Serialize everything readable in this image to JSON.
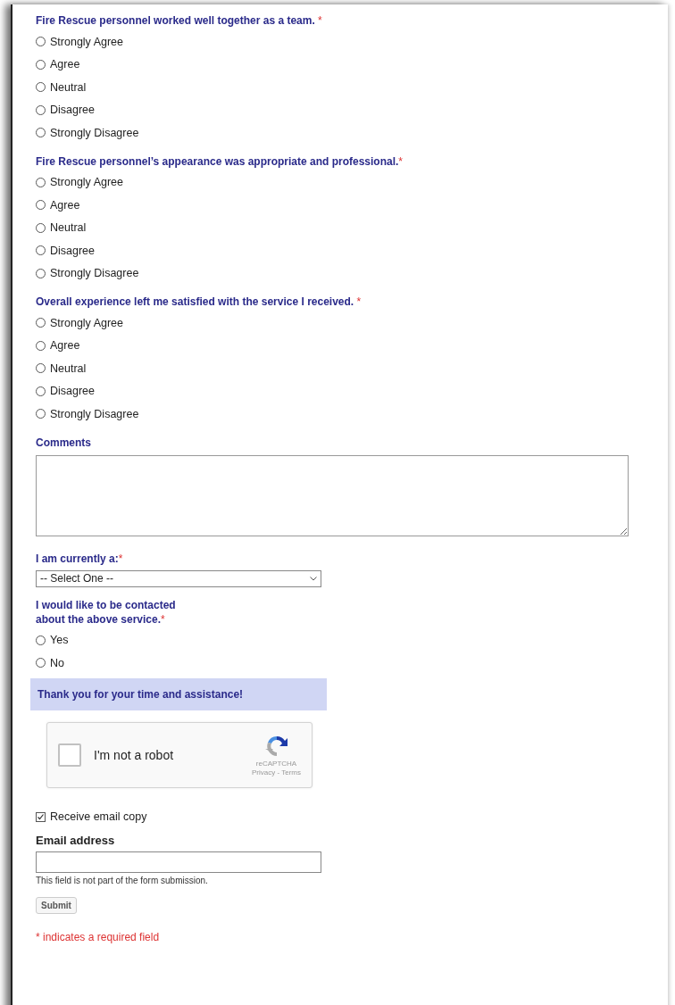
{
  "questions": [
    {
      "label": "Fire Rescue personnel worked well together as a team. ",
      "mark": "*",
      "options": [
        {
          "label": "Strongly Agree",
          "selected": false
        },
        {
          "label": "Agree",
          "selected": false
        },
        {
          "label": "Neutral",
          "selected": false
        },
        {
          "label": "Disagree",
          "selected": false
        },
        {
          "label": "Strongly Disagree",
          "selected": false
        }
      ]
    },
    {
      "label": "Fire Rescue personnel’s appearance was appropriate and professional.",
      "mark": "*",
      "options": [
        {
          "label": "Strongly Agree",
          "selected": false
        },
        {
          "label": "Agree",
          "selected": false
        },
        {
          "label": "Neutral",
          "selected": false
        },
        {
          "label": "Disagree",
          "selected": false
        },
        {
          "label": "Strongly Disagree",
          "selected": false
        }
      ]
    },
    {
      "label": "Overall experience left me satisfied with the service I received. ",
      "mark": "*",
      "options": [
        {
          "label": "Strongly Agree",
          "selected": false
        },
        {
          "label": "Agree",
          "selected": false
        },
        {
          "label": "Neutral",
          "selected": false
        },
        {
          "label": "Disagree",
          "selected": false
        },
        {
          "label": "Strongly Disagree",
          "selected": false
        }
      ]
    }
  ],
  "comments": {
    "label": "Comments"
  },
  "role": {
    "label": "I am currently a:",
    "mark": "*",
    "value": "-- Select One --"
  },
  "contact": {
    "label_lines": [
      "I would like to be contacted",
      "about the above service."
    ],
    "mark": "*",
    "options": [
      {
        "label": "Yes",
        "selected": false
      },
      {
        "label": "No",
        "selected": false
      }
    ]
  },
  "thanks": "Thank you for your time and assistance!",
  "captcha": {
    "label": "I'm not a robot",
    "checked": false,
    "brand": "reCAPTCHA",
    "links": "Privacy - Terms"
  },
  "email_copy": {
    "label": "Receive email copy",
    "checked": true
  },
  "email": {
    "label": "Email address",
    "note": "This field is not part of the form submission."
  },
  "submit": "Submit",
  "footnote": "* indicates a required field"
}
